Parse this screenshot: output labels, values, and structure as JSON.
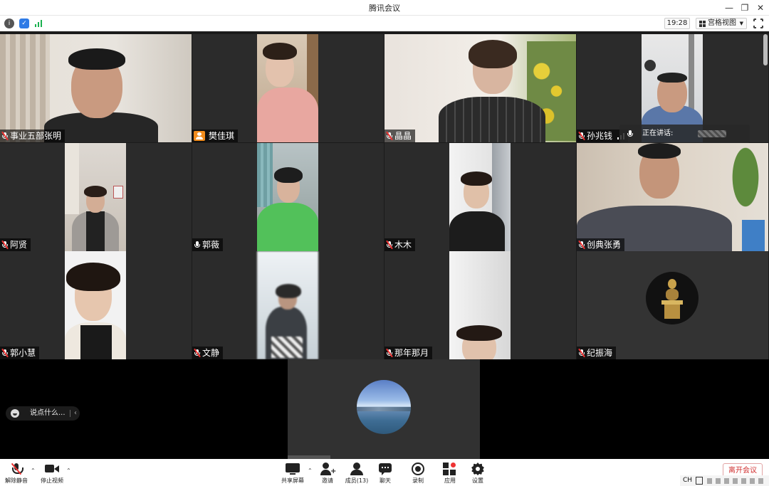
{
  "window": {
    "title": "腾讯会议"
  },
  "infobar": {
    "time": "19:28",
    "view_mode": "宫格视图"
  },
  "speaking": {
    "label": "正在讲话:"
  },
  "participants": [
    {
      "name": "事业五部张明"
    },
    {
      "name": "樊佳琪"
    },
    {
      "name": "晶晶"
    },
    {
      "name": "孙兆钱"
    },
    {
      "name": "阿贤"
    },
    {
      "name": "郭薇"
    },
    {
      "name": "木木"
    },
    {
      "name": "创典张勇"
    },
    {
      "name": "郭小慧"
    },
    {
      "name": "文静"
    },
    {
      "name": "那年那月"
    },
    {
      "name": "纪振海"
    }
  ],
  "chat": {
    "placeholder": "说点什么..."
  },
  "toolbar": {
    "unmute": "解除静音",
    "stop_video": "停止视频",
    "share_screen": "共享屏幕",
    "invite": "邀请",
    "members": "成员(13)",
    "chat": "聊天",
    "record": "录制",
    "apps": "应用",
    "settings": "设置",
    "leave": "离开会议"
  },
  "ime": {
    "lang": "CH"
  }
}
